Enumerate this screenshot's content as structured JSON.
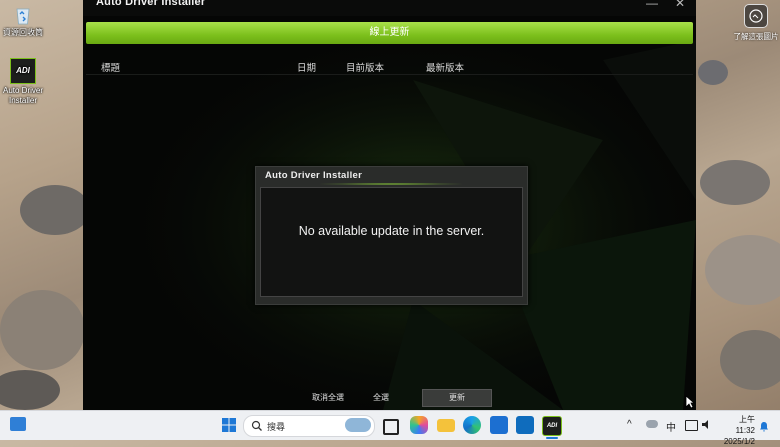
{
  "desktop": {
    "icons": [
      {
        "label": "資源回收筒",
        "icon": "recycle-bin-icon"
      },
      {
        "label": "Auto Driver Installer",
        "icon": "adi-app-icon"
      }
    ],
    "learn_label": "了解這張圖片"
  },
  "app": {
    "title": "Auto Driver Installer",
    "minimize": "—",
    "close": "✕",
    "online_update": "線上更新",
    "columns": [
      "標題",
      "日期",
      "目前版本",
      "最新版本"
    ],
    "cancel_all": "取消全選",
    "select_all": "全選",
    "update": "更新",
    "accent_color": "#7cc01c"
  },
  "dialog": {
    "title": "Auto Driver Installer",
    "message": "No available update in the server."
  },
  "taskbar": {
    "search_placeholder": "搜尋",
    "ime": "中",
    "time": "上午 11:32",
    "date": "2025/1/2"
  }
}
